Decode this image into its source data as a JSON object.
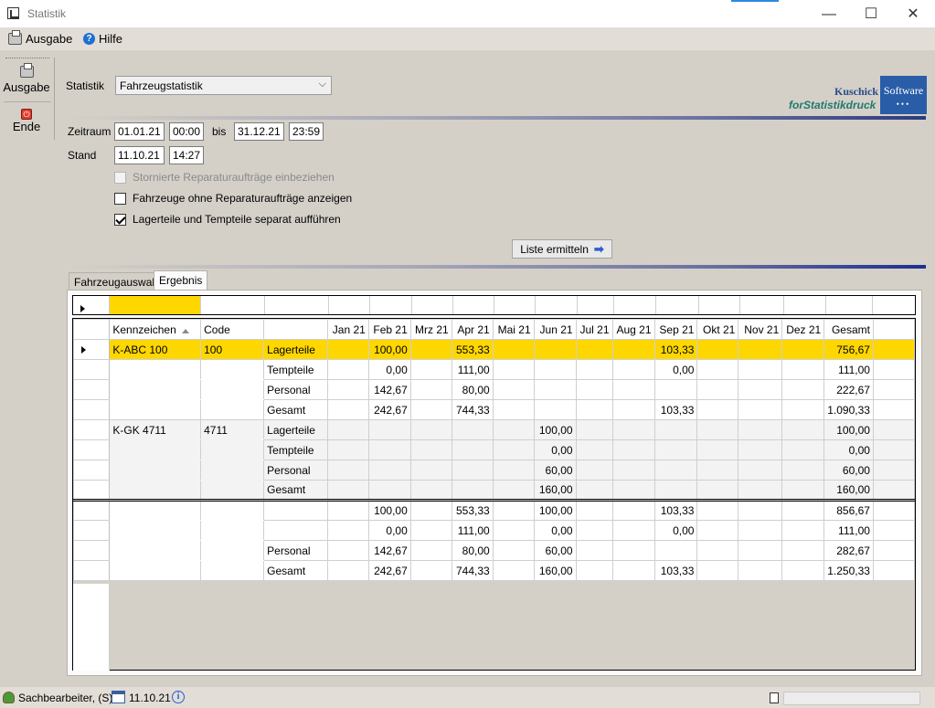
{
  "window": {
    "title": "Statistik",
    "minimize": "—",
    "maximize": "☐",
    "close": "✕"
  },
  "menu": {
    "ausgabe": "Ausgabe",
    "hilfe": "Hilfe"
  },
  "leftbar": {
    "ausgabe": "Ausgabe",
    "ende": "Ende"
  },
  "form": {
    "statistik_label": "Statistik",
    "statistik_value": "Fahrzeugstatistik",
    "zeitraum_label": "Zeitraum",
    "from_date": "01.01.21",
    "from_time": "00:00",
    "bis_label": "bis",
    "to_date": "31.12.21",
    "to_time": "23:59",
    "stand_label": "Stand",
    "stand_date": "11.10.21",
    "stand_time": "14:27",
    "cb1": "Stornierte Reparaturaufträge einbeziehen",
    "cb2": "Fahrzeuge ohne Reparaturaufträge anzeigen",
    "cb3": "Lagerteile und Tempteile separat aufführen",
    "button": "Liste ermitteln"
  },
  "logo": {
    "kuschick": "Kuschick",
    "software": "Software",
    "dots": "•••",
    "sub": "forStatistikdruck"
  },
  "tabs": {
    "tab1": "Fahrzeugauswahl",
    "tab2": "Ergebnis"
  },
  "grid": {
    "headers": {
      "kennzeichen": "Kennzeichen",
      "code": "Code",
      "type": "",
      "jan": "Jan 21",
      "feb": "Feb 21",
      "mrz": "Mrz 21",
      "apr": "Apr 21",
      "mai": "Mai 21",
      "jun": "Jun 21",
      "jul": "Jul 21",
      "aug": "Aug 21",
      "sep": "Sep 21",
      "okt": "Okt 21",
      "nov": "Nov 21",
      "dez": "Dez 21",
      "gesamt": "Gesamt"
    },
    "rows": [
      {
        "kz": "K-ABC 100",
        "code": "100",
        "typ": "Lagerteile",
        "feb": "100,00",
        "apr": "553,33",
        "jun": "",
        "sep": "103,33",
        "gesamt": "756,67"
      },
      {
        "kz": "",
        "code": "",
        "typ": "Tempteile",
        "feb": "0,00",
        "apr": "111,00",
        "jun": "",
        "sep": "0,00",
        "gesamt": "111,00"
      },
      {
        "kz": "",
        "code": "",
        "typ": "Personal",
        "feb": "142,67",
        "apr": "80,00",
        "jun": "",
        "sep": "",
        "gesamt": "222,67"
      },
      {
        "kz": "",
        "code": "",
        "typ": "Gesamt",
        "feb": "242,67",
        "apr": "744,33",
        "jun": "",
        "sep": "103,33",
        "gesamt": "1.090,33"
      },
      {
        "kz": "K-GK 4711",
        "code": "4711",
        "typ": "Lagerteile",
        "feb": "",
        "apr": "",
        "jun": "100,00",
        "sep": "",
        "gesamt": "100,00"
      },
      {
        "kz": "",
        "code": "",
        "typ": "Tempteile",
        "feb": "",
        "apr": "",
        "jun": "0,00",
        "sep": "",
        "gesamt": "0,00"
      },
      {
        "kz": "",
        "code": "",
        "typ": "Personal",
        "feb": "",
        "apr": "",
        "jun": "60,00",
        "sep": "",
        "gesamt": "60,00"
      },
      {
        "kz": "",
        "code": "",
        "typ": "Gesamt",
        "feb": "",
        "apr": "",
        "jun": "160,00",
        "sep": "",
        "gesamt": "160,00"
      },
      {
        "kz": "",
        "code": "",
        "typ": "",
        "feb": "100,00",
        "apr": "553,33",
        "jun": "100,00",
        "sep": "103,33",
        "gesamt": "856,67"
      },
      {
        "kz": "",
        "code": "",
        "typ": "",
        "feb": "0,00",
        "apr": "111,00",
        "jun": "0,00",
        "sep": "0,00",
        "gesamt": "111,00"
      },
      {
        "kz": "",
        "code": "",
        "typ": "Personal",
        "feb": "142,67",
        "apr": "80,00",
        "jun": "60,00",
        "sep": "",
        "gesamt": "282,67"
      },
      {
        "kz": "",
        "code": "",
        "typ": "Gesamt",
        "feb": "242,67",
        "apr": "744,33",
        "jun": "160,00",
        "sep": "103,33",
        "gesamt": "1.250,33"
      }
    ]
  },
  "status": {
    "user": "Sachbearbeiter, (S)",
    "date": "11.10.21"
  }
}
